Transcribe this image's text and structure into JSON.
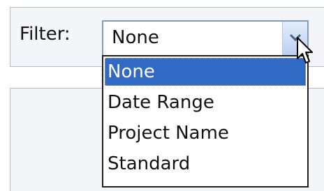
{
  "filter": {
    "label": "Filter:",
    "selected_value": "None",
    "options": [
      "None",
      "Date Range",
      "Project Name",
      "Standard"
    ],
    "highlighted_index": 0
  },
  "icons": {
    "dropdown_arrow": "chevron-down-icon",
    "pointer": "mouse-pointer-icon"
  },
  "colors": {
    "highlight": "#316ac5",
    "panel_bg": "#f4f5f8",
    "border": "#b5bcc8"
  }
}
